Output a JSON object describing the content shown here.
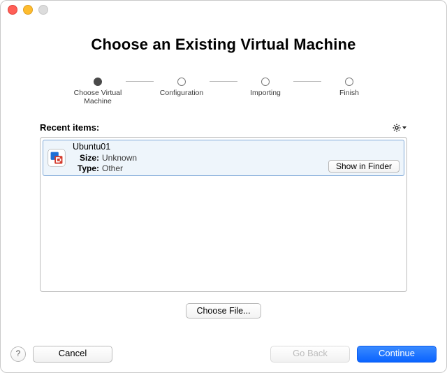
{
  "title": "Choose an Existing Virtual Machine",
  "stepper": {
    "steps": [
      {
        "label": "Choose Virtual\nMachine",
        "active": true
      },
      {
        "label": "Configuration",
        "active": false
      },
      {
        "label": "Importing",
        "active": false
      },
      {
        "label": "Finish",
        "active": false
      }
    ]
  },
  "recent": {
    "header": "Recent items:",
    "items": [
      {
        "name": "Ubuntu01",
        "size_label": "Size:",
        "size_value": "Unknown",
        "type_label": "Type:",
        "type_value": "Other",
        "show_in_finder_label": "Show in Finder"
      }
    ]
  },
  "choose_file_label": "Choose File...",
  "footer": {
    "help": "?",
    "cancel": "Cancel",
    "go_back": "Go Back",
    "continue": "Continue"
  }
}
